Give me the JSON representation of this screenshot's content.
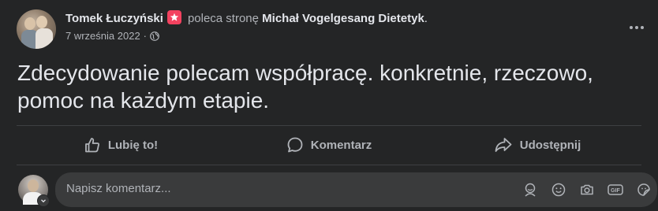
{
  "post": {
    "author": "Tomek Łuczyński",
    "action": "poleca stronę",
    "page_name": "Michał Vogelgesang Dietetyk",
    "page_suffix": ".",
    "date": "7 września 2022",
    "separator": "·",
    "body": "Zdecydowanie polecam współpracę. konkretnie, rzeczowo, pomoc na każdym etapie."
  },
  "actions": {
    "like": "Lubię to!",
    "comment": "Komentarz",
    "share": "Udostępnij"
  },
  "comment": {
    "placeholder": "Napisz komentarz..."
  },
  "icons": {
    "recommend": "recommend-icon",
    "audience": "globe-icon",
    "more": "more-options-icon",
    "like": "thumbs-up-icon",
    "comment": "comment-bubble-icon",
    "share": "share-arrow-icon",
    "avatar_sticker": "avatar-sticker-icon",
    "emoji": "emoji-icon",
    "camera": "camera-icon",
    "gif": "gif-icon",
    "sticker": "sticker-icon"
  },
  "colors": {
    "background": "#242526",
    "recommend_badge": "#f3425f",
    "secondary_text": "#b0b3b8",
    "input_background": "#3a3b3c"
  }
}
